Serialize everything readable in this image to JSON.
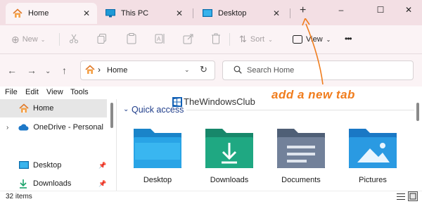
{
  "tabs": [
    {
      "label": "Home",
      "icon": "home-icon"
    },
    {
      "label": "This PC",
      "icon": "monitor-icon"
    },
    {
      "label": "Desktop",
      "icon": "desktop-icon"
    }
  ],
  "new_tab_symbol": "+",
  "window_controls": {
    "minimize": "–",
    "maximize": "☐",
    "close": "✕"
  },
  "toolbar": {
    "new_label": "New",
    "sort_label": "Sort",
    "view_label": "View",
    "more": "•••"
  },
  "address": {
    "path": "Home",
    "separator": "›"
  },
  "search": {
    "placeholder": "Search Home"
  },
  "menu": [
    "File",
    "Edit",
    "View",
    "Tools"
  ],
  "sidebar": {
    "items": [
      {
        "label": "Home",
        "icon": "home-icon"
      },
      {
        "label": "OneDrive - Personal",
        "icon": "cloud-icon"
      },
      {
        "label": "Desktop",
        "icon": "desktop-icon"
      },
      {
        "label": "Downloads",
        "icon": "download-icon"
      }
    ]
  },
  "quick_access": {
    "title": "Quick access",
    "folders": [
      "Desktop",
      "Downloads",
      "Documents",
      "Pictures"
    ]
  },
  "watermark": "TheWindowsClub",
  "annotation": "add a new tab",
  "status": {
    "items": "32 items"
  },
  "colors": {
    "accent": "#f07c1c",
    "tab_bg": "#f3dfe4",
    "active_tab": "#fbf3f5",
    "quick_access_text": "#1f3d8a"
  }
}
